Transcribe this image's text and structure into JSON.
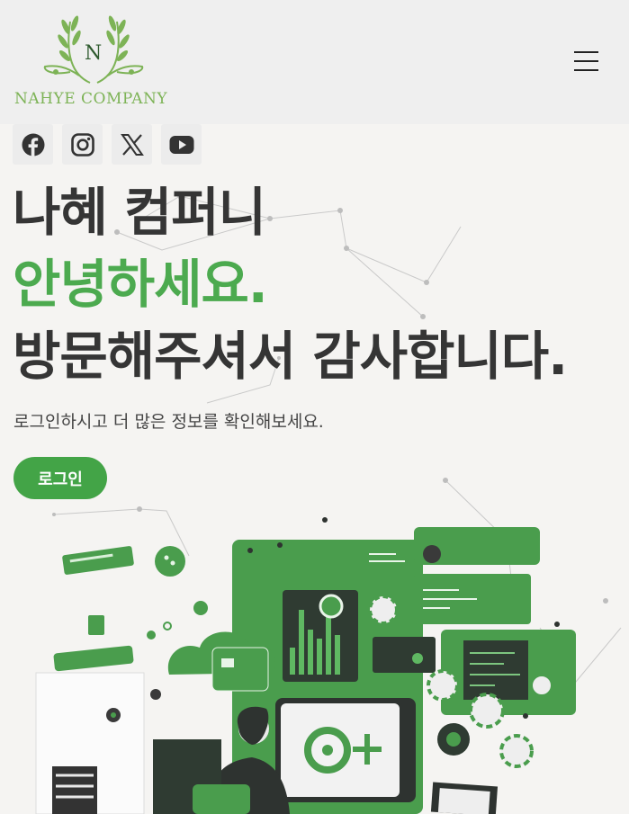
{
  "brand": {
    "logo_letter": "N",
    "name": "NAHYE COMPANY"
  },
  "colors": {
    "accent": "#4caa4f",
    "button": "#43a447",
    "text_dark": "#353535",
    "header_bg": "#efefef"
  },
  "header": {
    "menu_icon": "hamburger-icon"
  },
  "social": [
    {
      "name": "facebook",
      "icon": "facebook-icon"
    },
    {
      "name": "instagram",
      "icon": "instagram-icon"
    },
    {
      "name": "x",
      "icon": "x-icon"
    },
    {
      "name": "youtube",
      "icon": "youtube-icon"
    }
  ],
  "hero": {
    "line1": "나혜 컴퍼니",
    "line2": "안녕하세요.",
    "line3": "방문해주셔서 감사합니다.",
    "subtitle": "로그인하시고 더 많은 정보를 확인해보세요.",
    "login_label": "로그인"
  }
}
